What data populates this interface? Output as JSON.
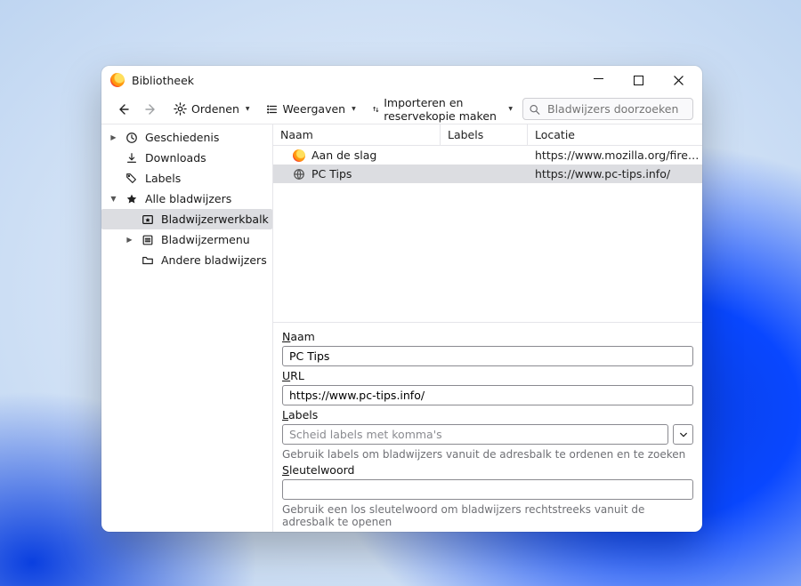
{
  "window": {
    "title": "Bibliotheek"
  },
  "toolbar": {
    "organize": "Ordenen",
    "views": "Weergaven",
    "import_backup": "Importeren en reservekopie maken",
    "search_placeholder": "Bladwijzers doorzoeken"
  },
  "sidebar": {
    "history": "Geschiedenis",
    "downloads": "Downloads",
    "labels": "Labels",
    "all_bookmarks": "Alle bladwijzers",
    "bookmarks_toolbar": "Bladwijzerwerkbalk",
    "bookmarks_menu": "Bladwijzermenu",
    "other_bookmarks": "Andere bladwijzers"
  },
  "columns": {
    "name": "Naam",
    "labels": "Labels",
    "location": "Locatie"
  },
  "rows": [
    {
      "name": "Aan de slag",
      "labels": "",
      "location": "https://www.mozilla.org/firefox/cen…",
      "icon": "firefox",
      "selected": false
    },
    {
      "name": "PC Tips",
      "labels": "",
      "location": "https://www.pc-tips.info/",
      "icon": "globe",
      "selected": true
    }
  ],
  "details": {
    "name_label": "Naam",
    "name_underline": "N",
    "name_value": "PC Tips",
    "url_label_under": "U",
    "url_label_rest": "RL",
    "url_value": "https://www.pc-tips.info/",
    "labels_label": "Labels",
    "labels_underline": "L",
    "labels_placeholder": "Scheid labels met komma's",
    "labels_hint": "Gebruik labels om bladwijzers vanuit de adresbalk te ordenen en te zoeken",
    "keyword_label": "Sleutelwoord",
    "keyword_underline": "S",
    "keyword_value": "",
    "keyword_hint": "Gebruik een los sleutelwoord om bladwijzers rechtstreeks vanuit de adresbalk te openen"
  }
}
